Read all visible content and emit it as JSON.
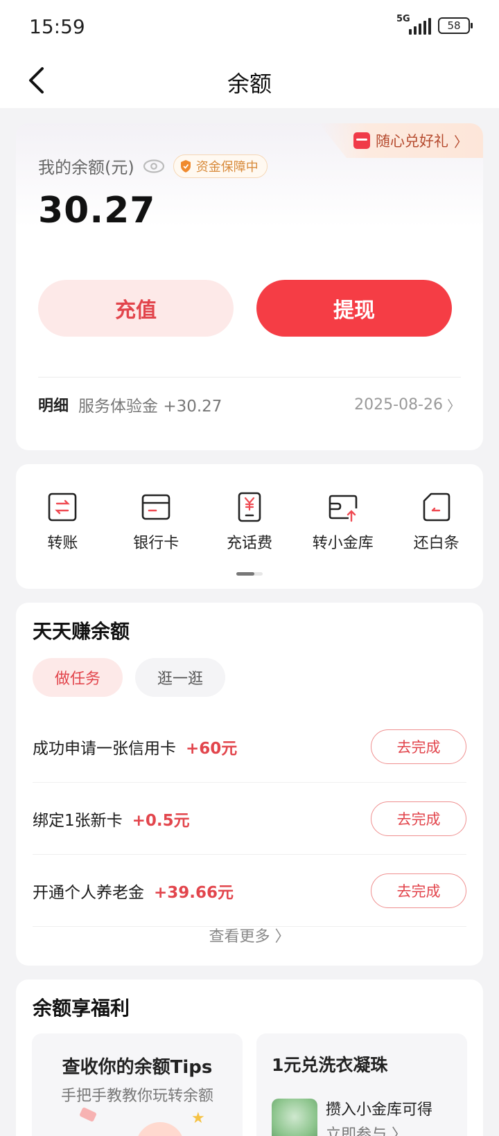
{
  "status_bar": {
    "time": "15:59",
    "network": "5G",
    "battery": "58"
  },
  "nav": {
    "title": "余额",
    "back_icon": "chevron-left-icon"
  },
  "balance": {
    "gift_text": "随心兑好礼",
    "label": "我的余额(元)",
    "safe_text": "资金保障中",
    "amount": "30.27",
    "recharge_label": "充值",
    "withdraw_label": "提现",
    "detail_label": "明细",
    "detail_text": "服务体验金 +30.27",
    "detail_date": "2025-08-26",
    "accent_color": "#f53d45"
  },
  "tools": [
    {
      "label": "转账",
      "icon": "transfer-icon"
    },
    {
      "label": "银行卡",
      "icon": "bank-card-icon"
    },
    {
      "label": "充话费",
      "icon": "phone-recharge-icon"
    },
    {
      "label": "转小金库",
      "icon": "vault-transfer-icon"
    },
    {
      "label": "还白条",
      "icon": "repay-icon"
    }
  ],
  "tasks": {
    "title": "天天赚余额",
    "tabs": [
      {
        "label": "做任务",
        "active": true
      },
      {
        "label": "逛一逛",
        "active": false
      }
    ],
    "items": [
      {
        "name": "成功申请一张信用卡",
        "reward": "+60元",
        "action": "去完成"
      },
      {
        "name": "绑定1张新卡",
        "reward": "+0.5元",
        "action": "去完成"
      },
      {
        "name": "开通个人养老金",
        "reward": "+39.66元",
        "action": "去完成"
      }
    ],
    "more_label": "查看更多"
  },
  "welfare": {
    "title": "余额享福利",
    "left": {
      "title": "查收你的余额Tips",
      "subtitle": "手把手教教你玩转余额"
    },
    "right": {
      "title": "1元兑洗衣凝珠",
      "line1": "攒入小金库可得",
      "line2": "立即参与"
    }
  }
}
